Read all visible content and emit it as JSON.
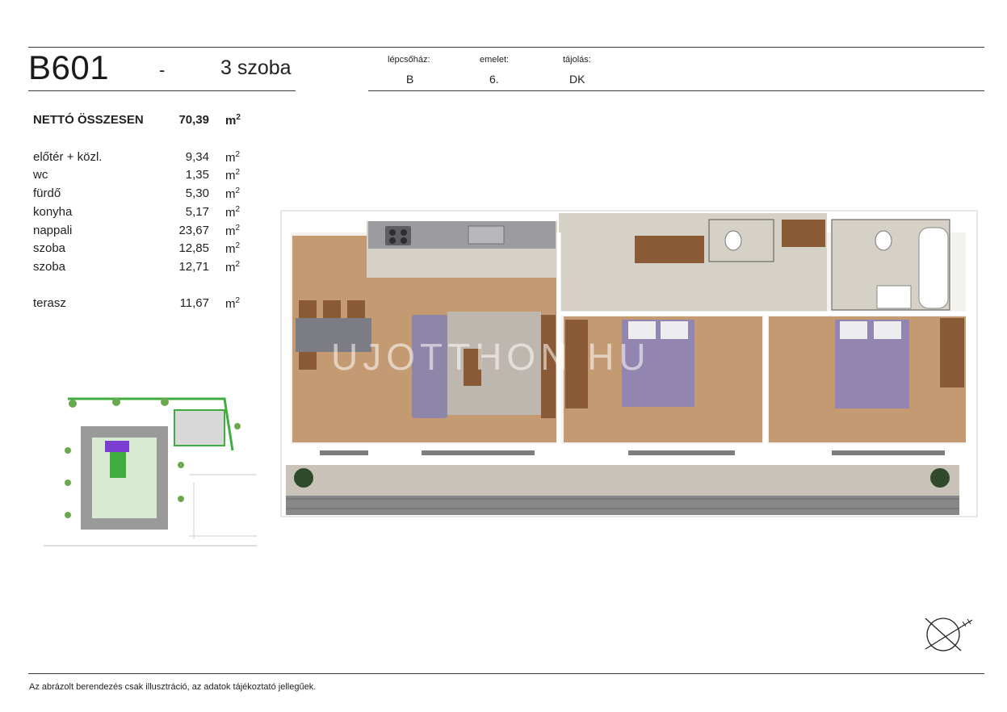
{
  "header": {
    "unit_code": "B601",
    "separator": "-",
    "rooms": "3 szoba",
    "meta": [
      {
        "label": "lépcsőház:",
        "value": "B"
      },
      {
        "label": "emelet:",
        "value": "6."
      },
      {
        "label": "tájolás:",
        "value": "DK"
      }
    ]
  },
  "areas": {
    "total": {
      "label": "NETTÓ ÖSSZESEN",
      "value": "70,39",
      "unit": "m",
      "unit_sup": "2"
    },
    "rooms": [
      {
        "label": "előtér + közl.",
        "value": "9,34",
        "unit": "m",
        "unit_sup": "2"
      },
      {
        "label": "wc",
        "value": "1,35",
        "unit": "m",
        "unit_sup": "2"
      },
      {
        "label": "fürdő",
        "value": "5,30",
        "unit": "m",
        "unit_sup": "2"
      },
      {
        "label": "konyha",
        "value": "5,17",
        "unit": "m",
        "unit_sup": "2"
      },
      {
        "label": "nappali",
        "value": "23,67",
        "unit": "m",
        "unit_sup": "2"
      },
      {
        "label": "szoba",
        "value": "12,85",
        "unit": "m",
        "unit_sup": "2"
      },
      {
        "label": "szoba",
        "value": "12,71",
        "unit": "m",
        "unit_sup": "2"
      }
    ],
    "terrace": {
      "label": "terasz",
      "value": "11,67",
      "unit": "m",
      "unit_sup": "2"
    }
  },
  "watermark": "UJOTTHON HU",
  "footnote": "Az abrázolt berendezés csak illusztráció, az adatok tájékoztató jellegűek.",
  "colors": {
    "floor_wood": "#c49a72",
    "floor_tile": "#d6d1c6",
    "bed_purple": "#9286b0",
    "sofa_purple": "#8e86a8",
    "kitchen_grey": "#9c9ca0",
    "terrace_grey": "#888888",
    "highlight_purple": "#7a3fd0",
    "site_green": "#3fae3f"
  }
}
